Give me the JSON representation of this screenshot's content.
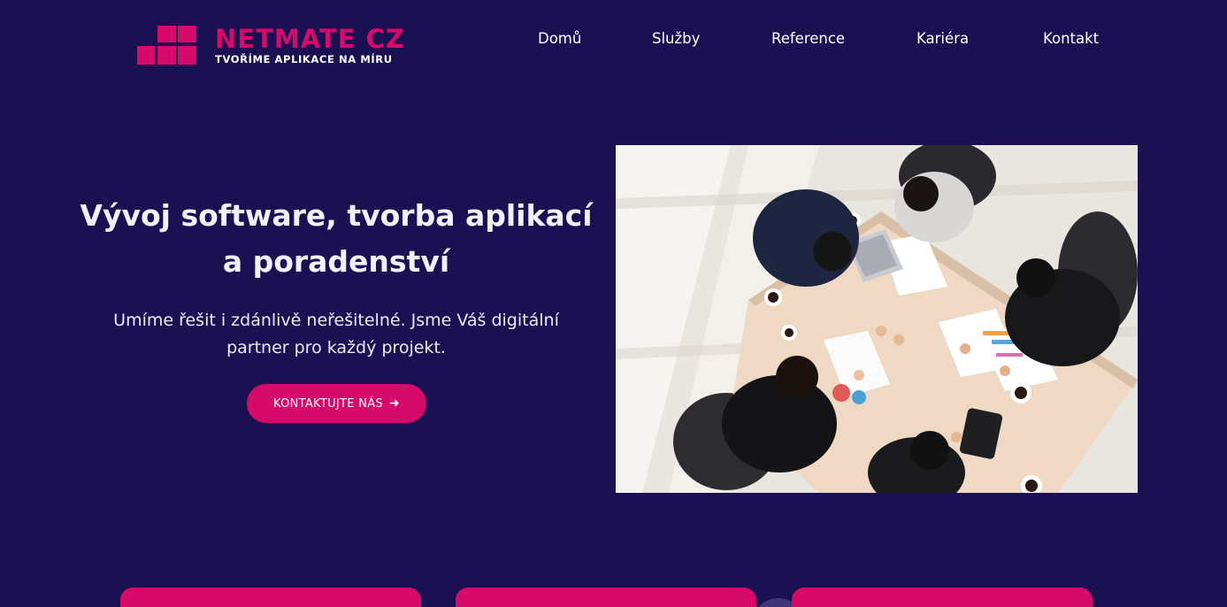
{
  "brand": {
    "name": "NETMATE CZ",
    "tagline": "TVOŘÍME APLIKACE NA MÍRU",
    "accent_color": "#d50a6b",
    "background_color": "#1b1152"
  },
  "nav": {
    "items": [
      {
        "label": "Domů"
      },
      {
        "label": "Služby"
      },
      {
        "label": "Reference"
      },
      {
        "label": "Kariéra"
      },
      {
        "label": "Kontakt"
      }
    ]
  },
  "hero": {
    "title": "Vývoj software, tvorba aplikací a poradenství",
    "subtitle": "Umíme řešit i zdánlivě neřešitelné. Jsme Váš digitální partner pro každý projekt.",
    "cta_label": "KONTAKTUJTE NÁS",
    "cta_icon": "arrow-right-icon",
    "image_subject": "business-meeting-photo"
  }
}
